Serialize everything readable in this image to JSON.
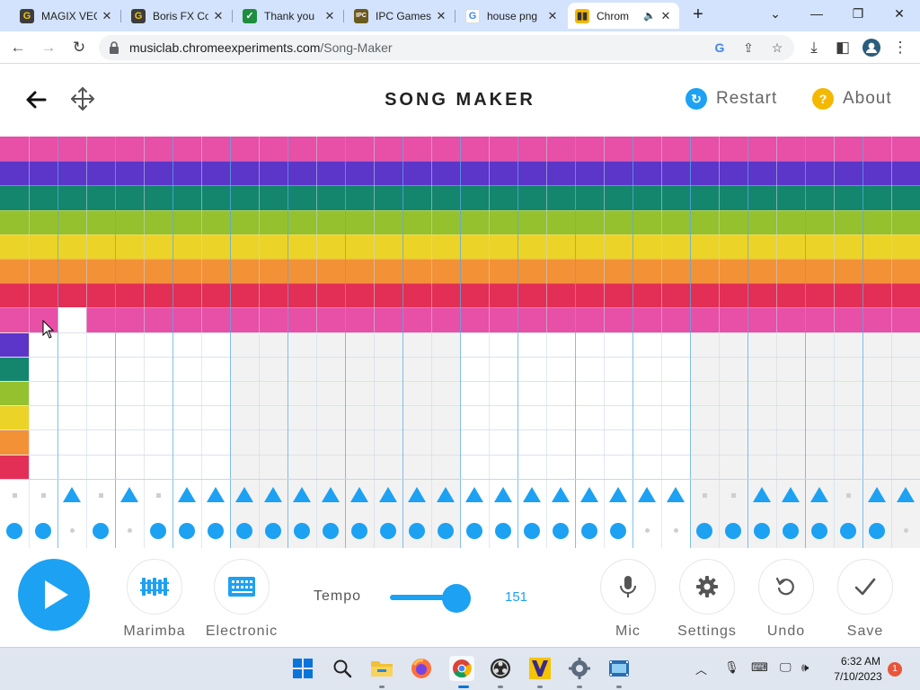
{
  "browser": {
    "tabs": [
      {
        "title": "MAGIX VEG",
        "favicon": "magix-g-icon",
        "color": "#3d3d3d"
      },
      {
        "title": "Boris FX Co",
        "favicon": "borisfx-g-icon",
        "color": "#3d3d3d"
      },
      {
        "title": "Thank you",
        "favicon": "sheets-check-icon",
        "color": "#1e8e3e"
      },
      {
        "title": "IPC Games",
        "favicon": "ipc-icon",
        "color": "#6b5a1e"
      },
      {
        "title": "house png",
        "favicon": "google-icon",
        "color": "#4285f4"
      },
      {
        "title": "Chrom",
        "favicon": "chrome-music-lab-icon",
        "color": "#f5b800"
      }
    ],
    "address": {
      "domain": "musiclab.chromeexperiments.com",
      "path": "/Song-Maker"
    }
  },
  "header": {
    "title": "SONG MAKER",
    "restart_label": "Restart",
    "about_label": "About",
    "restart_color": "#1da1f2",
    "about_color": "#f5b800"
  },
  "grid": {
    "melody_colors": [
      "#e84fa6",
      "#5c35c9",
      "#14866d",
      "#95c12e",
      "#ecd327",
      "#f39137",
      "#e32f55",
      "#e84fa6"
    ],
    "lower_key_colors": [
      "#5c35c9",
      "#14866d",
      "#95c12e",
      "#ecd327",
      "#f39137",
      "#e32f55"
    ],
    "columns": 32,
    "unfilled_cells_in_top_rows": [
      {
        "row": 7,
        "col": 2
      }
    ],
    "percussion_top": "00101011111111111111111100111011",
    "percussion_bottom": "11010111111111111111110011111110",
    "accent_color": "#1da1f2"
  },
  "controls": {
    "play_icon": "play-icon",
    "instrument1_label": "Marimba",
    "instrument2_label": "Electronic",
    "tempo_label": "Tempo",
    "tempo_value": "151",
    "tempo_fraction": 0.8,
    "mic_label": "Mic",
    "settings_label": "Settings",
    "undo_label": "Undo",
    "save_label": "Save"
  },
  "taskbar": {
    "time": "6:32 AM",
    "date": "7/10/2023",
    "notifications": "1"
  }
}
